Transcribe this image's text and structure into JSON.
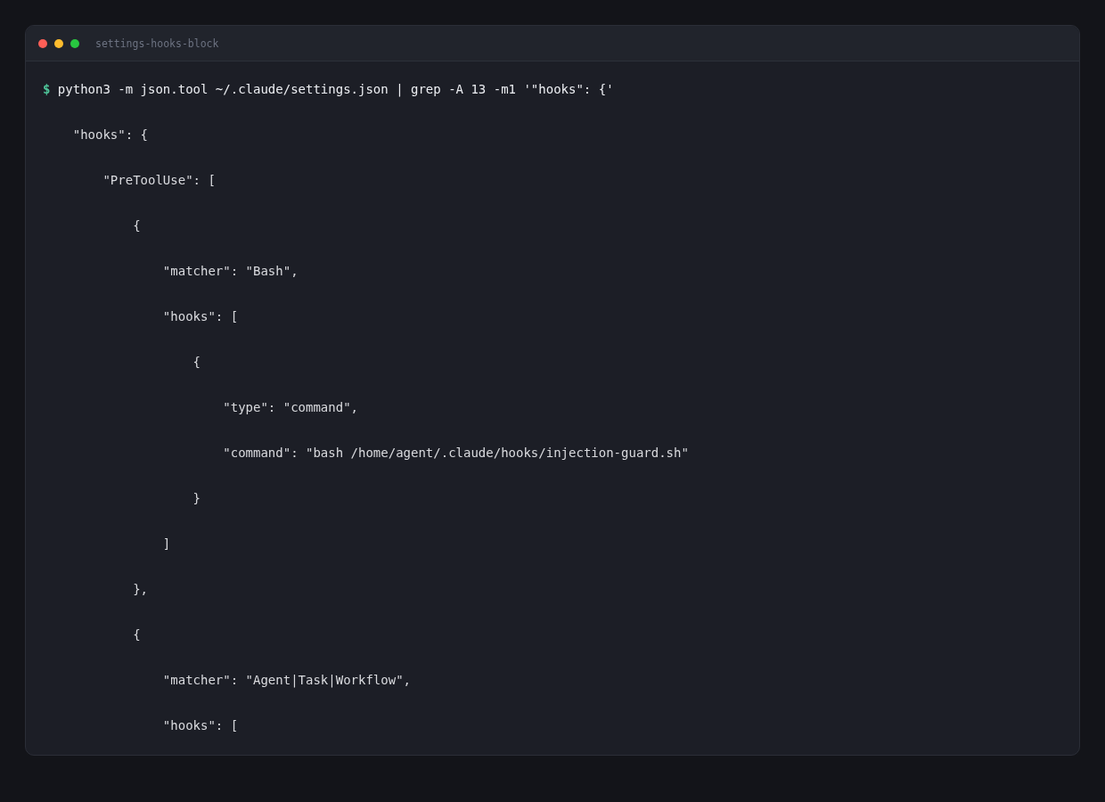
{
  "window": {
    "title": "settings-hooks-block"
  },
  "terminal": {
    "prompt": {
      "symbol": "$",
      "command": "python3 -m json.tool ~/.claude/settings.json | grep -A 13 -m1 '\"hooks\": {'"
    },
    "output": [
      "    \"hooks\": {",
      "        \"PreToolUse\": [",
      "            {",
      "                \"matcher\": \"Bash\",",
      "                \"hooks\": [",
      "                    {",
      "                        \"type\": \"command\",",
      "                        \"command\": \"bash /home/agent/.claude/hooks/injection-guard.sh\"",
      "                    }",
      "                ]",
      "            },",
      "            {",
      "                \"matcher\": \"Agent|Task|Workflow\",",
      "                \"hooks\": ["
    ]
  }
}
